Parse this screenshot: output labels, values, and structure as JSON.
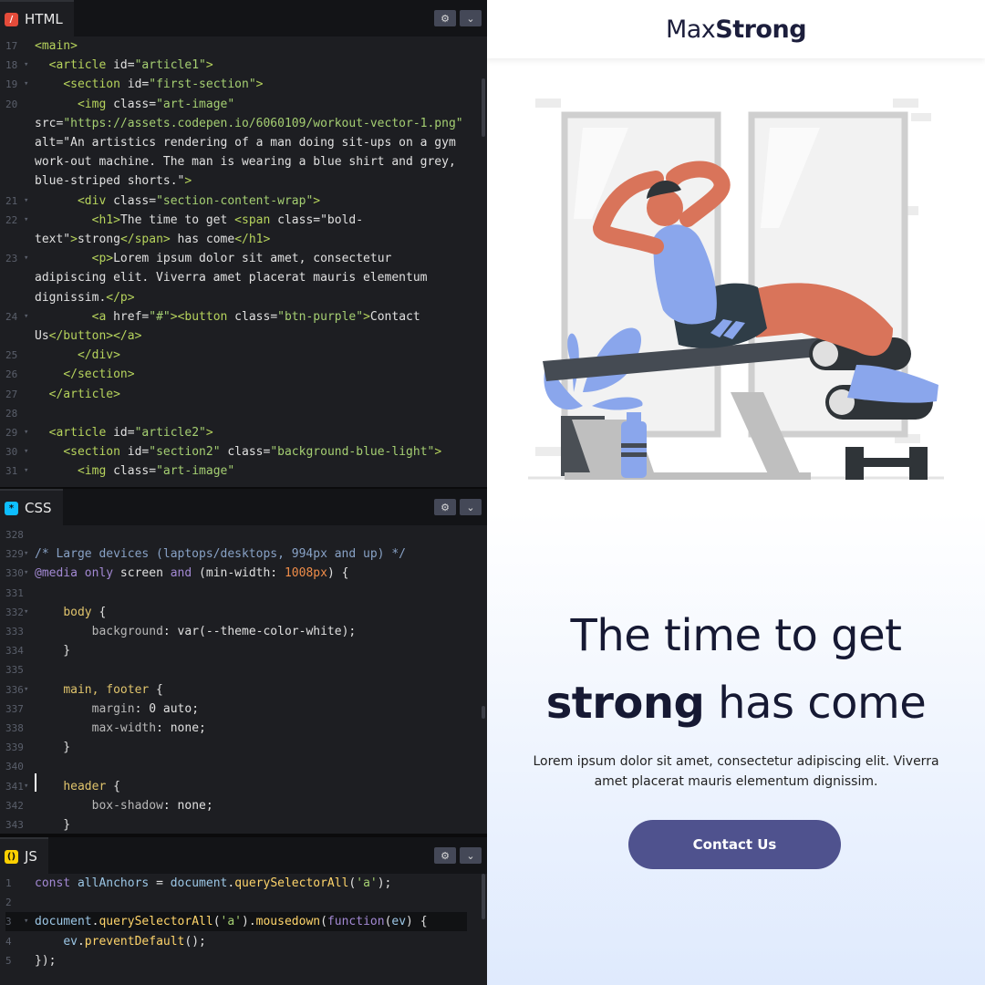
{
  "editor": {
    "panels": {
      "html": {
        "label": "HTML",
        "badge": "/",
        "settings": "⚙",
        "collapse": "⌄"
      },
      "css": {
        "label": "CSS",
        "badge": "*",
        "settings": "⚙",
        "collapse": "⌄"
      },
      "js": {
        "label": "JS",
        "badge": "()",
        "settings": "⚙",
        "collapse": "⌄"
      }
    },
    "html_code": [
      {
        "n": "17",
        "f": "",
        "t": "<main>"
      },
      {
        "n": "18",
        "f": "▾",
        "t": "  <article id=\"article1\">"
      },
      {
        "n": "19",
        "f": "▾",
        "t": "    <section id=\"first-section\">"
      },
      {
        "n": "20",
        "f": "",
        "t": "      <img class=\"art-image\""
      },
      {
        "n": "",
        "f": "",
        "t": "src=\"https://assets.codepen.io/6060109/workout-vector-1.png\""
      },
      {
        "n": "",
        "f": "",
        "t": "alt=\"An artistics rendering of a man doing sit-ups on a gym"
      },
      {
        "n": "",
        "f": "",
        "t": "work-out machine. The man is wearing a blue shirt and grey,"
      },
      {
        "n": "",
        "f": "",
        "t": "blue-striped shorts.\">"
      },
      {
        "n": "21",
        "f": "▾",
        "t": "      <div class=\"section-content-wrap\">"
      },
      {
        "n": "22",
        "f": "▾",
        "t": "        <h1>The time to get <span class=\"bold-"
      },
      {
        "n": "",
        "f": "",
        "t": "text\">strong</span> has come</h1>"
      },
      {
        "n": "23",
        "f": "▾",
        "t": "        <p>Lorem ipsum dolor sit amet, consectetur"
      },
      {
        "n": "",
        "f": "",
        "t": "adipiscing elit. Viverra amet placerat mauris elementum"
      },
      {
        "n": "",
        "f": "",
        "t": "dignissim.</p>"
      },
      {
        "n": "24",
        "f": "▾",
        "t": "        <a href=\"#\"><button class=\"btn-purple\">Contact"
      },
      {
        "n": "",
        "f": "",
        "t": "Us</button></a>"
      },
      {
        "n": "25",
        "f": "",
        "t": "      </div>"
      },
      {
        "n": "26",
        "f": "",
        "t": "    </section>"
      },
      {
        "n": "27",
        "f": "",
        "t": "  </article>"
      },
      {
        "n": "28",
        "f": "",
        "t": ""
      },
      {
        "n": "29",
        "f": "▾",
        "t": "  <article id=\"article2\">"
      },
      {
        "n": "30",
        "f": "▾",
        "t": "    <section id=\"section2\" class=\"background-blue-light\">"
      },
      {
        "n": "31",
        "f": "▾",
        "t": "      <img class=\"art-image\""
      }
    ],
    "css_code": [
      {
        "n": "328",
        "f": "",
        "t": ""
      },
      {
        "n": "329",
        "f": "▾",
        "t": "/* Large devices (laptops/desktops, 994px and up) */"
      },
      {
        "n": "330",
        "f": "▾",
        "t": "@media only screen and (min-width: 1008px) {"
      },
      {
        "n": "331",
        "f": "",
        "t": ""
      },
      {
        "n": "332",
        "f": "▾",
        "t": "    body {"
      },
      {
        "n": "333",
        "f": "",
        "t": "        background: var(--theme-color-white);"
      },
      {
        "n": "334",
        "f": "",
        "t": "    }"
      },
      {
        "n": "335",
        "f": "",
        "t": ""
      },
      {
        "n": "336",
        "f": "▾",
        "t": "    main, footer {"
      },
      {
        "n": "337",
        "f": "",
        "t": "        margin: 0 auto;"
      },
      {
        "n": "338",
        "f": "",
        "t": "        max-width: none;"
      },
      {
        "n": "339",
        "f": "",
        "t": "    }"
      },
      {
        "n": "340",
        "f": "",
        "t": ""
      },
      {
        "n": "341",
        "f": "▾",
        "t": "    header {"
      },
      {
        "n": "342",
        "f": "",
        "t": "        box-shadow: none;"
      },
      {
        "n": "343",
        "f": "",
        "t": "    }"
      }
    ],
    "js_code": [
      {
        "n": "1",
        "f": "",
        "t": "const allAnchors = document.querySelectorAll('a');"
      },
      {
        "n": "2",
        "f": "",
        "t": ""
      },
      {
        "n": "3",
        "f": "▾",
        "t": "document.querySelectorAll('a').mousedown(function(ev) {"
      },
      {
        "n": "4",
        "f": "",
        "t": "    ev.preventDefault();"
      },
      {
        "n": "5",
        "f": "",
        "t": "});"
      }
    ]
  },
  "preview": {
    "brand_regular": "Max",
    "brand_bold": "Strong",
    "hero": {
      "title_line1": "The time to get",
      "title_bold": "strong",
      "title_rest": " has come",
      "text": "Lorem ipsum dolor sit amet, consectetur adipiscing elit. Viverra amet placerat mauris elementum dignissim.",
      "cta": "Contact Us"
    },
    "colors": {
      "brand_navy": "#1c1e3c",
      "cta_purple": "#4f528e",
      "gradient_light_blue": "#dfeafd"
    }
  }
}
